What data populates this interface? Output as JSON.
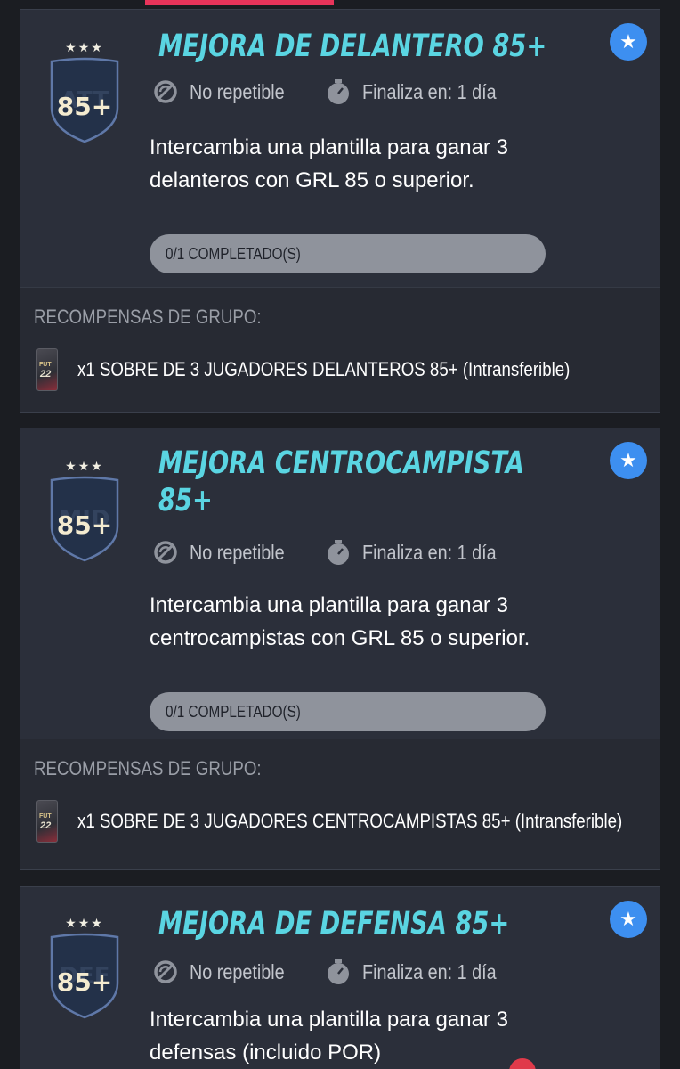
{
  "colors": {
    "accent_title": "#5ad5e2",
    "favorite": "#3d8ff0",
    "tab_indicator": "#e8345a",
    "notification": "#e03a4a"
  },
  "cards": [
    {
      "badge_rating": "85+",
      "badge_position": "ATT",
      "stars": "★★★",
      "title": "MEJORA DE DELANTERO 85+",
      "repeat_icon": "no-repeat-icon",
      "repeat_label": "No repetible",
      "timer_icon": "stopwatch-icon",
      "timer_label": "Finaliza en: 1 día",
      "description": "Intercambia una plantilla para ganar 3 delanteros con GRL 85 o superior.",
      "progress_label": "0/1 COMPLETADO(S)",
      "progress_value": 0,
      "rewards_label": "RECOMPENSAS DE GRUPO:",
      "reward_icon": "fut22-pack-icon",
      "reward_text": "x1 SOBRE DE 3 JUGADORES DELANTEROS 85+ (Intransferible)"
    },
    {
      "badge_rating": "85+",
      "badge_position": "MID",
      "stars": "★★★",
      "title": "MEJORA CENTROCAMPISTA 85+",
      "repeat_icon": "no-repeat-icon",
      "repeat_label": "No repetible",
      "timer_icon": "stopwatch-icon",
      "timer_label": "Finaliza en: 1 día",
      "description": "Intercambia una plantilla para ganar 3 centrocampistas con GRL 85 o superior.",
      "progress_label": "0/1 COMPLETADO(S)",
      "progress_value": 0,
      "rewards_label": "RECOMPENSAS DE GRUPO:",
      "reward_icon": "fut22-pack-icon",
      "reward_text": "x1 SOBRE DE 3 JUGADORES CENTROCAMPISTAS 85+ (Intransferible)"
    },
    {
      "badge_rating": "85+",
      "badge_position": "DEF",
      "stars": "★★★",
      "title": "MEJORA DE DEFENSA 85+",
      "repeat_icon": "no-repeat-icon",
      "repeat_label": "No repetible",
      "timer_icon": "stopwatch-icon",
      "timer_label": "Finaliza en: 1 día",
      "description": "Intercambia una plantilla para ganar 3 defensas (incluido POR)"
    }
  ],
  "pack_fut_label": "FUT",
  "pack_year_label": "22"
}
